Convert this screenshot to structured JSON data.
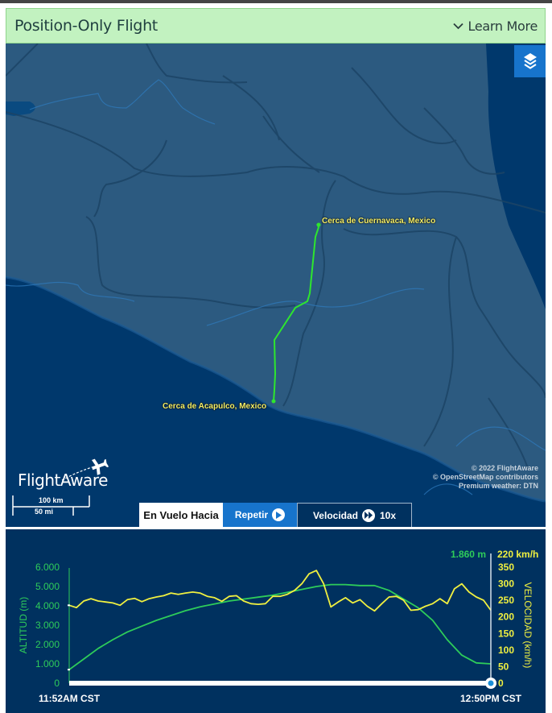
{
  "header": {
    "title": "Position-Only Flight",
    "learn_more": "Learn More",
    "learn_more_icon": "chevron-down-icon"
  },
  "map": {
    "layers_icon": "layers-icon",
    "origin_label": "Cerca de Acapulco, Mexico",
    "destination_label": "Cerca de Cuernavaca, Mexico",
    "logo_text": "FlightAware",
    "scale_km": "100 km",
    "scale_mi": "50 mi",
    "copyright": [
      "© 2022 FlightAware",
      "© OpenStreetMap contributors",
      "Premium weather: DTN"
    ],
    "route_color": "#2ee62e",
    "label_color": "#f5f06a"
  },
  "controls": {
    "status": "En Vuelo Hacia",
    "replay": "Repetir",
    "speed_label": "Velocidad",
    "speed_value": "10x"
  },
  "chart_data": {
    "type": "line",
    "x_start_label": "11:52AM CST",
    "x_end_label": "12:50PM CST",
    "current_altitude": "1.860 m",
    "current_speed": "220 km/h",
    "progress": 1.0,
    "left_axis": {
      "label": "ALTITUD (m)",
      "ticks": [
        "0",
        "1.000",
        "2.000",
        "3.000",
        "4.000",
        "5.000",
        "6.000"
      ],
      "range": [
        0,
        6000
      ],
      "color": "#2ecc5a"
    },
    "right_axis": {
      "label": "VELOCIDAD (km/h)",
      "ticks": [
        "0",
        "50",
        "100",
        "150",
        "200",
        "250",
        "300",
        "350"
      ],
      "range": [
        0,
        350
      ],
      "color": "#f0f040"
    },
    "x_range": [
      0,
      58
    ],
    "series": [
      {
        "name": "Altitud",
        "axis": "left",
        "color": "#2ecc5a",
        "x": [
          0,
          2,
          4,
          6,
          8,
          10,
          12,
          14,
          16,
          18,
          20,
          22,
          24,
          26,
          28,
          30,
          32,
          34,
          36,
          38,
          40,
          42,
          44,
          46,
          48,
          50,
          52,
          54,
          56,
          58
        ],
        "values": [
          700,
          1250,
          1800,
          2250,
          2650,
          2950,
          3250,
          3500,
          3750,
          3950,
          4100,
          4250,
          4350,
          4450,
          4550,
          4700,
          4850,
          5000,
          5100,
          5100,
          5050,
          5050,
          4800,
          4350,
          3900,
          3250,
          2250,
          1450,
          1050,
          1000
        ]
      },
      {
        "name": "Velocidad",
        "axis": "right",
        "color": "#f0f040",
        "x": [
          0,
          1,
          2,
          3,
          4,
          5,
          6,
          7,
          8,
          9,
          10,
          11,
          12,
          13,
          14,
          15,
          16,
          17,
          18,
          19,
          20,
          21,
          22,
          23,
          24,
          25,
          26,
          27,
          28,
          29,
          30,
          31,
          32,
          33,
          34,
          35,
          36,
          37,
          38,
          39,
          40,
          41,
          42,
          43,
          44,
          45,
          46,
          47,
          48,
          49,
          50,
          51,
          52,
          53,
          54,
          55,
          56,
          57,
          58
        ],
        "values": [
          235,
          228,
          248,
          255,
          248,
          245,
          242,
          235,
          252,
          256,
          246,
          255,
          260,
          264,
          272,
          268,
          272,
          275,
          272,
          262,
          258,
          247,
          262,
          264,
          248,
          240,
          238,
          240,
          262,
          262,
          268,
          280,
          300,
          330,
          340,
          300,
          230,
          245,
          258,
          242,
          252,
          232,
          218,
          240,
          260,
          262,
          250,
          220,
          222,
          232,
          240,
          255,
          240,
          285,
          300,
          275,
          260,
          250,
          220
        ]
      }
    ]
  }
}
